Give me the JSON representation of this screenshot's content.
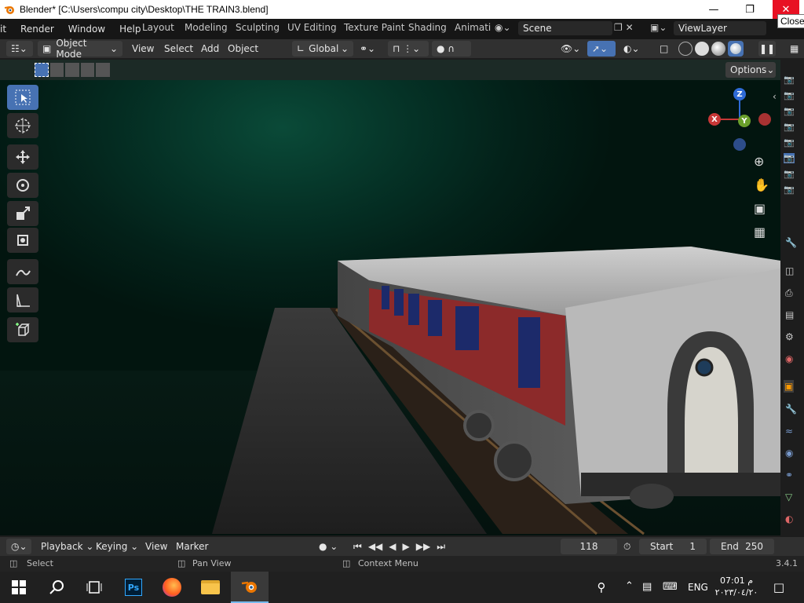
{
  "window": {
    "title": "Blender* [C:\\Users\\compu city\\Desktop\\THE TRAIN3.blend]",
    "close_tooltip": "Close"
  },
  "menu": [
    "it",
    "Render",
    "Window",
    "Help"
  ],
  "workspaces": [
    "Layout",
    "Modeling",
    "Sculpting",
    "UV Editing",
    "Texture Paint",
    "Shading",
    "Animati"
  ],
  "scene": {
    "name": "Scene",
    "view_layer": "ViewLayer"
  },
  "header": {
    "mode": "Object Mode",
    "menus": [
      "View",
      "Select",
      "Add",
      "Object"
    ],
    "transform_orientation": "Global",
    "options": "Options"
  },
  "gizmo": {
    "z": "Z",
    "x": "X",
    "y": "Y"
  },
  "timeline": {
    "menus": [
      "Playback",
      "Keying",
      "View",
      "Marker"
    ],
    "current_frame": "118",
    "start_label": "Start",
    "start": "1",
    "end_label": "End",
    "end": "250"
  },
  "status": {
    "left": "Select",
    "mid": "Pan View",
    "right": "Context Menu",
    "version": "3.4.1"
  },
  "taskbar": {
    "time": "07:01 م",
    "date": "٢٠٢٣/٠٤/٢٠",
    "lang": "ENG"
  },
  "colors": {
    "accent": "#4772b3",
    "close_red": "#e81123",
    "scene_green": "#0a4a38"
  }
}
